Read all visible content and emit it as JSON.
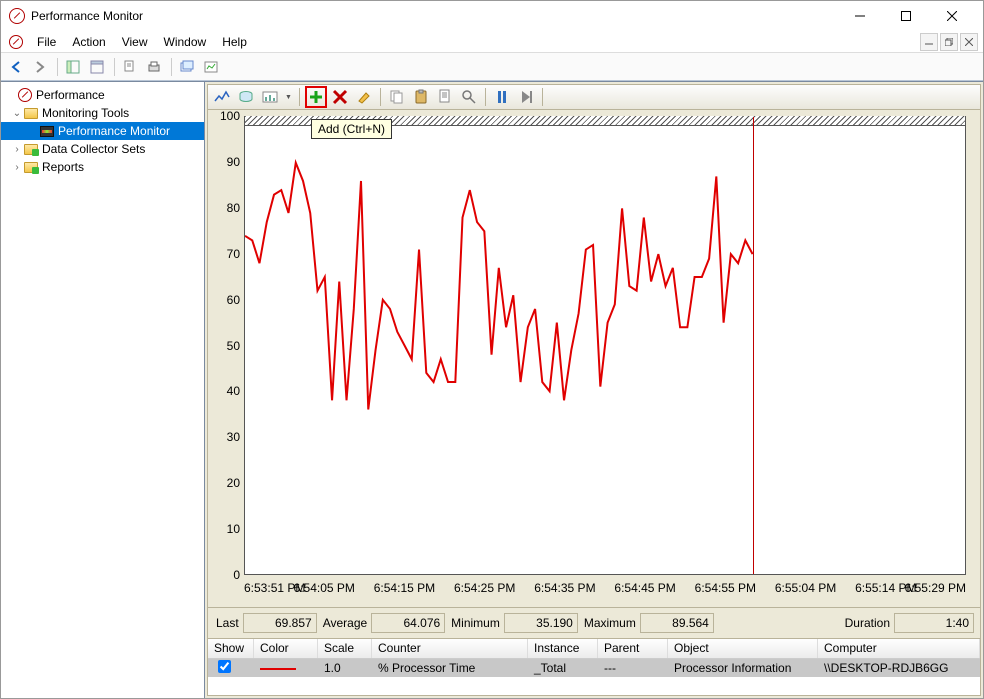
{
  "window": {
    "title": "Performance Monitor"
  },
  "menubar": {
    "file": "File",
    "action": "Action",
    "view": "View",
    "window": "Window",
    "help": "Help"
  },
  "tree": {
    "root": "Performance",
    "monitoring_tools": "Monitoring Tools",
    "performance_monitor": "Performance Monitor",
    "data_collector_sets": "Data Collector Sets",
    "reports": "Reports"
  },
  "right_toolbar": {
    "tooltip_add": "Add (Ctrl+N)"
  },
  "chart_data": {
    "type": "line",
    "title": "",
    "xlabel": "",
    "ylabel": "",
    "ylim": [
      0,
      100
    ],
    "y_ticks": [
      0,
      10,
      20,
      30,
      40,
      50,
      60,
      70,
      80,
      90,
      100
    ],
    "x_categories": [
      "6:53:51 PM",
      "6:54:05 PM",
      "6:54:15 PM",
      "6:54:25 PM",
      "6:54:35 PM",
      "6:54:45 PM",
      "6:54:55 PM",
      "6:55:04 PM",
      "6:55:14 PM",
      "6:55:29 PM"
    ],
    "cursor_x_fraction": 0.705,
    "series": [
      {
        "name": "% Processor Time",
        "color": "#e00000",
        "values": [
          74,
          73,
          68,
          77,
          83,
          84,
          79,
          90,
          86,
          79,
          62,
          65,
          38,
          64,
          38,
          58,
          86,
          36,
          49,
          60,
          58,
          53,
          50,
          47,
          71,
          44,
          42,
          47,
          42,
          42,
          78,
          84,
          77,
          75,
          48,
          67,
          54,
          61,
          42,
          54,
          58,
          42,
          40,
          55,
          38,
          49,
          57,
          71,
          72,
          41,
          55,
          59,
          80,
          63,
          62,
          78,
          64,
          70,
          63,
          67,
          54,
          54,
          65,
          65,
          69,
          87,
          55,
          70,
          68,
          73,
          70
        ]
      }
    ]
  },
  "stats": {
    "last_label": "Last",
    "last": "69.857",
    "avg_label": "Average",
    "avg": "64.076",
    "min_label": "Minimum",
    "min": "35.190",
    "max_label": "Maximum",
    "max": "89.564",
    "dur_label": "Duration",
    "dur": "1:40"
  },
  "counter_table": {
    "headers": {
      "show": "Show",
      "color": "Color",
      "scale": "Scale",
      "counter": "Counter",
      "instance": "Instance",
      "parent": "Parent",
      "object": "Object",
      "computer": "Computer"
    },
    "row": {
      "scale": "1.0",
      "counter": "% Processor Time",
      "instance": "_Total",
      "parent": "---",
      "object": "Processor Information",
      "computer": "\\\\DESKTOP-RDJB6GG"
    }
  }
}
